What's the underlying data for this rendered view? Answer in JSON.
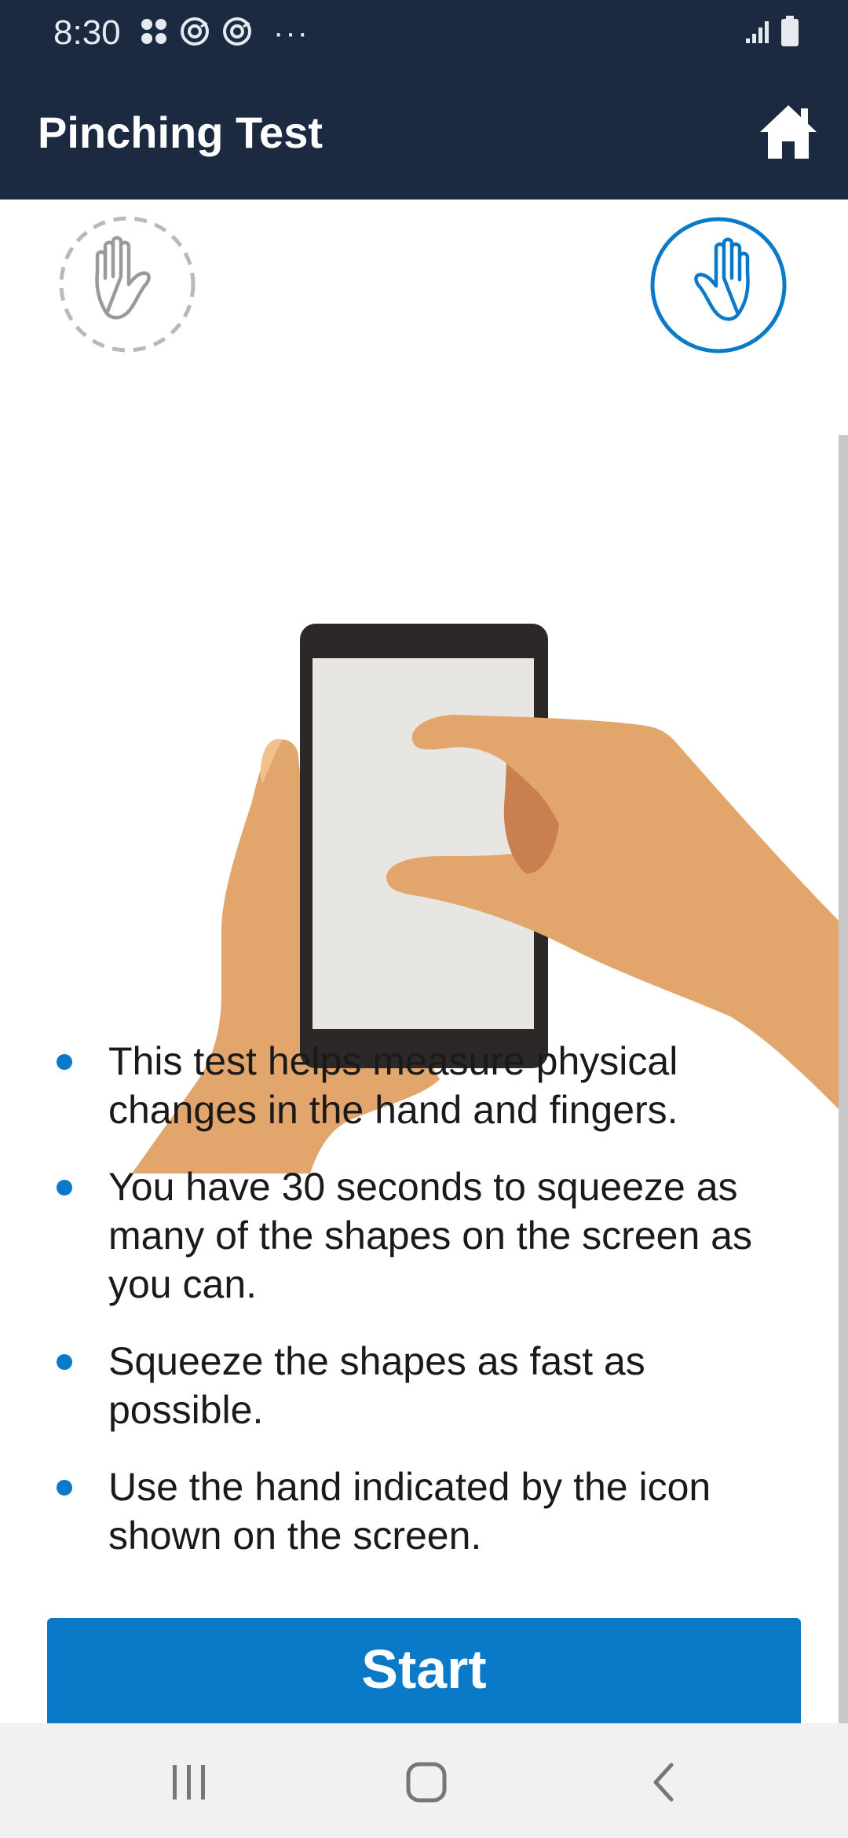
{
  "status_bar": {
    "time": "8:30",
    "overflow_indicator": "···",
    "left_icons": [
      "app-grid-icon",
      "sync-icon",
      "sync-icon"
    ],
    "right_icons": [
      "signal-icon",
      "battery-icon"
    ]
  },
  "app_bar": {
    "title": "Pinching Test",
    "home_icon": "home-icon"
  },
  "hand_indicators": {
    "left": {
      "icon": "left-hand-icon",
      "state": "inactive"
    },
    "right": {
      "icon": "right-hand-icon",
      "state": "active"
    }
  },
  "instructions": [
    "This test helps measure physical changes in the hand and fingers.",
    "You have 30 seconds to squeeze as many of the shapes on the screen as you can.",
    "Squeeze the shapes as fast as possible.",
    "Use the hand indicated by the icon shown on the screen."
  ],
  "start_button": {
    "label": "Start"
  },
  "nav_bar": {
    "buttons": [
      "recent-apps-icon",
      "home-nav-icon",
      "back-icon"
    ]
  },
  "colors": {
    "header_bg": "#1b2a41",
    "accent": "#0a7ac8",
    "skin": "#e2a56b",
    "skin_shadow": "#c97f4f",
    "phone_body": "#2d2828",
    "phone_screen": "#e8e6e2"
  }
}
